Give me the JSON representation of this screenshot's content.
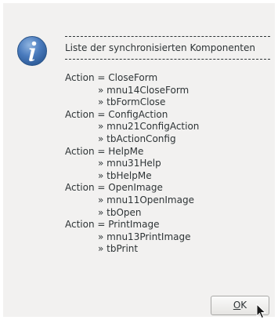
{
  "dialog": {
    "heading": "Liste der synchronisierten Komponenten",
    "groups": [
      {
        "action": "Action = CloseForm",
        "components": [
          "» mnu14CloseForm",
          "» tbFormClose"
        ]
      },
      {
        "action": "Action = ConfigAction",
        "components": [
          "» mnu21ConfigAction",
          "» tbActionConfig"
        ]
      },
      {
        "action": "Action = HelpMe",
        "components": [
          "» mnu31Help",
          "» tbHelpMe"
        ]
      },
      {
        "action": "Action = OpenImage",
        "components": [
          "» mnu11OpenImage",
          "» tbOpen"
        ]
      },
      {
        "action": "Action = PrintImage",
        "components": [
          "» mnu13PrintImage",
          "» tbPrint"
        ]
      }
    ],
    "ok_mnemonic": "O",
    "ok_rest": "K"
  },
  "icons": {
    "info": "info-icon",
    "cursor": "mouse-pointer-icon"
  },
  "colors": {
    "icon_blue": "#3f6ea9",
    "dialog_bg": "#f2f1f0"
  }
}
